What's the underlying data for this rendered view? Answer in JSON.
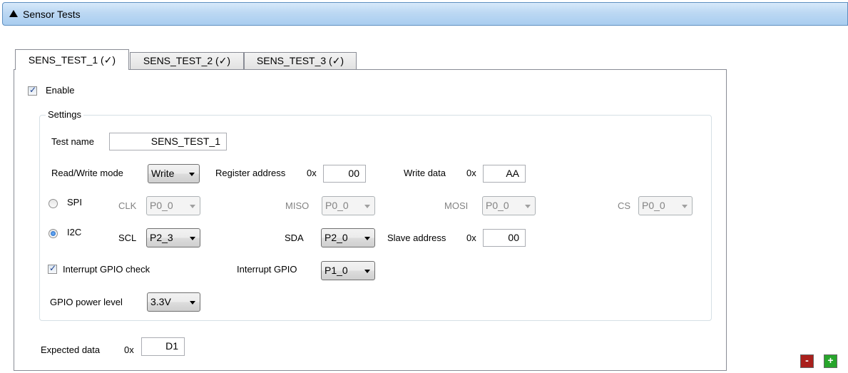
{
  "section": {
    "title": "Sensor Tests"
  },
  "tabs": [
    {
      "label": "SENS_TEST_1 (✓)",
      "active": true
    },
    {
      "label": "SENS_TEST_2 (✓)",
      "active": false
    },
    {
      "label": "SENS_TEST_3 (✓)",
      "active": false
    }
  ],
  "enable": {
    "label": "Enable",
    "checked": true
  },
  "settings": {
    "legend": "Settings",
    "test_name": {
      "label": "Test name",
      "value": "SENS_TEST_1"
    },
    "rw_mode": {
      "label": "Read/Write mode",
      "value": "Write"
    },
    "register_address": {
      "label": "Register address",
      "prefix": "0x",
      "value": "00"
    },
    "write_data": {
      "label": "Write data",
      "prefix": "0x",
      "value": "AA"
    },
    "spi": {
      "label": "SPI",
      "selected": false,
      "clk": {
        "label": "CLK",
        "value": "P0_0"
      },
      "miso": {
        "label": "MISO",
        "value": "P0_0"
      },
      "mosi": {
        "label": "MOSI",
        "value": "P0_0"
      },
      "cs": {
        "label": "CS",
        "value": "P0_0"
      }
    },
    "i2c": {
      "label": "I2C",
      "selected": true,
      "scl": {
        "label": "SCL",
        "value": "P2_3"
      },
      "sda": {
        "label": "SDA",
        "value": "P2_0"
      },
      "slave_address": {
        "label": "Slave address",
        "prefix": "0x",
        "value": "00"
      }
    },
    "interrupt_check": {
      "label": "Interrupt GPIO check",
      "checked": true
    },
    "interrupt_gpio": {
      "label": "Interrupt GPIO",
      "value": "P1_0"
    },
    "gpio_power": {
      "label": "GPIO power level",
      "value": "3.3V"
    }
  },
  "expected_data": {
    "label": "Expected data",
    "prefix": "0x",
    "value": "D1"
  },
  "buttons": {
    "remove": "-",
    "add": "+"
  },
  "icons": {
    "collapse": "triangle-up-icon",
    "check": "checkmark-icon",
    "dropdown": "chevron-down-icon"
  }
}
